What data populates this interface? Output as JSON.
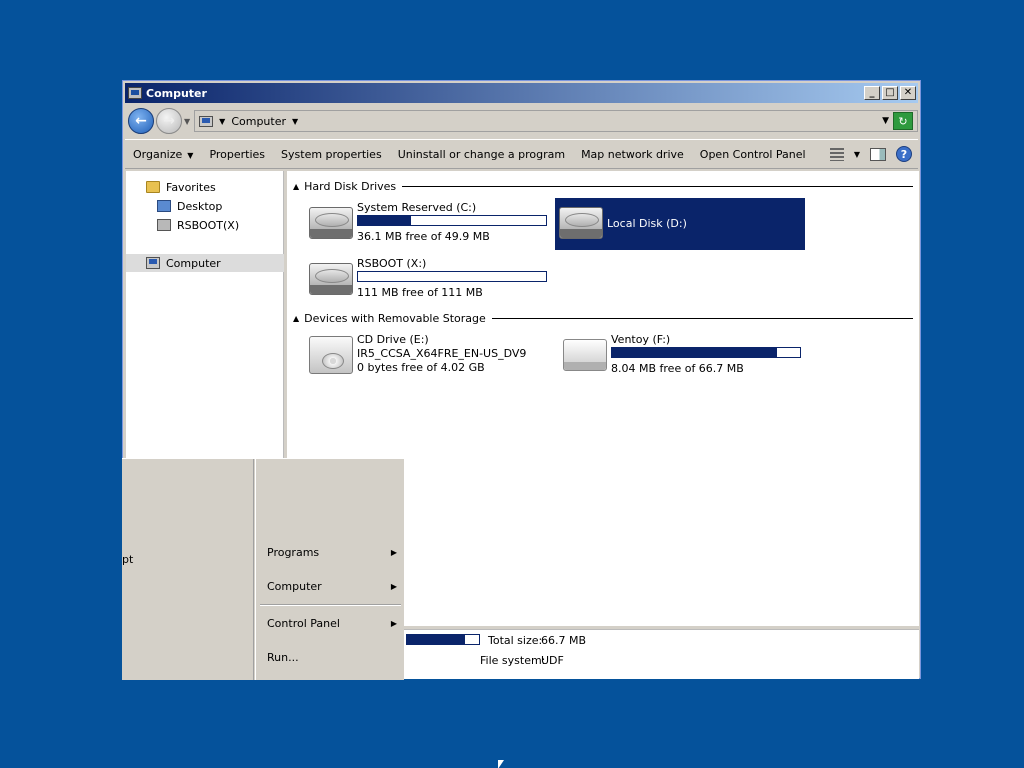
{
  "window": {
    "title": "Computer",
    "minimize": "_",
    "maximize": "□",
    "close": "✕"
  },
  "address": {
    "location": "Computer"
  },
  "toolbar": {
    "organize": "Organize",
    "properties": "Properties",
    "system_properties": "System properties",
    "uninstall": "Uninstall or change a program",
    "map_drive": "Map network drive",
    "control_panel": "Open Control Panel"
  },
  "nav": {
    "favorites": "Favorites",
    "desktop": "Desktop",
    "rsboot": "RSBOOT(X)",
    "computer": "Computer"
  },
  "groups": {
    "hdd": "Hard Disk Drives",
    "removable": "Devices with Removable Storage"
  },
  "drives": [
    {
      "name": "System Reserved (C:)",
      "info": "36.1 MB free of 49.9 MB",
      "used_fraction": 0.28
    },
    {
      "name": "Local Disk (D:)",
      "selected": true
    },
    {
      "name": "RSBOOT (X:)",
      "info": "111 MB free of 111 MB",
      "used_fraction": 0.0
    },
    {
      "name": "CD Drive (E:)",
      "sub": "IR5_CCSA_X64FRE_EN-US_DV9",
      "info": "0 bytes free of 4.02 GB"
    },
    {
      "name": "Ventoy (F:)",
      "info": "8.04 MB free of 66.7 MB",
      "used_fraction": 0.88
    }
  ],
  "details": {
    "total_size_label": "Total size:",
    "total_size_value": "66.7 MB",
    "fs_label": "File system:",
    "fs_value": "UDF",
    "used_fraction": 0.8
  },
  "startmenu": {
    "left_text": "pt",
    "programs": "Programs",
    "computer": "Computer",
    "control_panel": "Control Panel",
    "run": "Run..."
  },
  "colors": {
    "desktop": "#05529b",
    "selection": "#0a246a"
  }
}
